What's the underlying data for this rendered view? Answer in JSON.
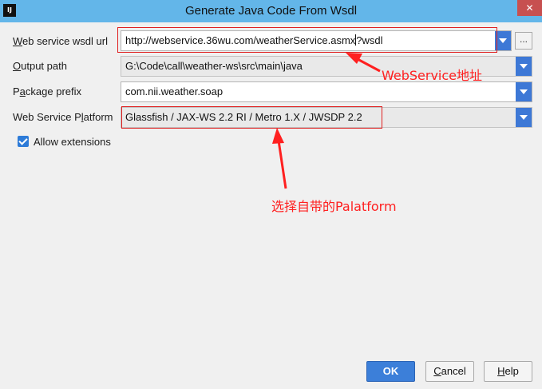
{
  "window": {
    "title": "Generate Java Code From Wsdl",
    "app_icon_text": "IJ",
    "close_symbol": "✕"
  },
  "form": {
    "wsdl_url": {
      "label_mnemonic": "W",
      "label_rest": "eb service wsdl url",
      "value_before_caret": "http://webservice.36wu.com/weatherService.asmx",
      "value_after_caret": "?wsdl",
      "browse_label": "..."
    },
    "output_path": {
      "label_mnemonic": "O",
      "label_rest": "utput path",
      "value": "G:\\Code\\call\\weather-ws\\src\\main\\java"
    },
    "package_prefix": {
      "label_before": "P",
      "label_mnemonic": "a",
      "label_after": "ckage prefix",
      "value": "com.nii.weather.soap"
    },
    "platform": {
      "label_before": "Web Service P",
      "label_mnemonic": "l",
      "label_after": "atform",
      "value": "Glassfish / JAX-WS 2.2 RI / Metro 1.X / JWSDP 2.2"
    },
    "allow_extensions": {
      "label": "Allow extensions",
      "checked": true
    }
  },
  "annotations": {
    "webservice_note": "WebService地址",
    "platform_note": "选择自带的Palatform",
    "color": "#ff2020"
  },
  "buttons": {
    "ok": "OK",
    "cancel_before": "",
    "cancel_mnemonic": "C",
    "cancel_after": "ancel",
    "help_before": "",
    "help_mnemonic": "H",
    "help_after": "elp"
  },
  "colors": {
    "titlebar": "#63b6e9",
    "accent": "#3c7fd9",
    "dropdown": "#3d78d6",
    "close": "#c75050"
  }
}
